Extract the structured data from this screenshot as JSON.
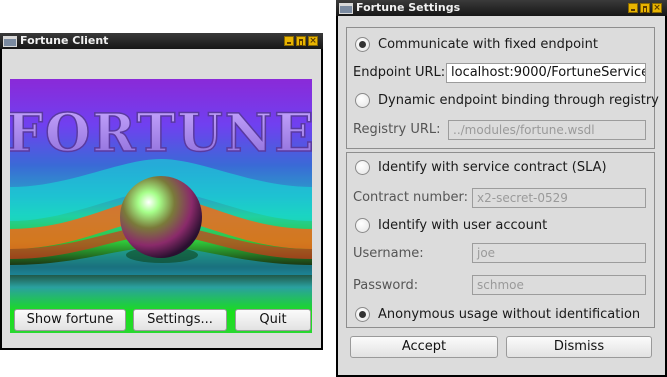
{
  "client": {
    "title": "Fortune Client",
    "art_text": "FORTUNE",
    "art_corner": "©",
    "buttons": {
      "show": "Show fortune",
      "settings": "Settings...",
      "quit": "Quit"
    }
  },
  "settings": {
    "title": "Fortune Settings",
    "endpoint": {
      "fixed_label": "Communicate with fixed endpoint",
      "fixed_selected": true,
      "url_label": "Endpoint URL:",
      "url_value": "localhost:9000/FortuneService",
      "dynamic_label": "Dynamic endpoint binding through registry",
      "dynamic_selected": false,
      "registry_label": "Registry URL:",
      "registry_value": "../modules/fortune.wsdl"
    },
    "identity": {
      "sla_label": "Identify with service contract (SLA)",
      "contract_label": "Contract number:",
      "contract_value": "x2-secret-0529",
      "user_label": "Identify with user account",
      "username_label": "Username:",
      "username_value": "joe",
      "password_label": "Password:",
      "password_value": "schmoe",
      "anon_label": "Anonymous usage without identification",
      "anon_selected": true
    },
    "buttons": {
      "accept": "Accept",
      "dismiss": "Dismiss"
    }
  },
  "colors": {
    "titlebar": "#222222",
    "title_button": "#e8b400",
    "window_bg": "#dcdcdc"
  }
}
